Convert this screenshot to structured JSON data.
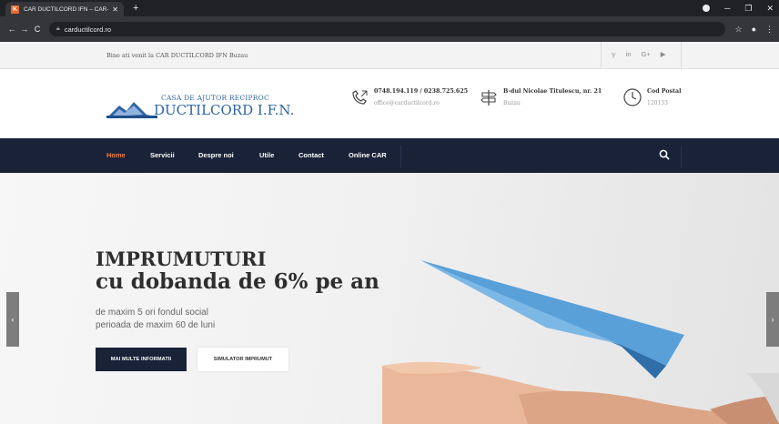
{
  "browser": {
    "tab_title": "CAR DUCTILCORD IFN – CAR-ul ...",
    "tab_favicon": "K",
    "new_tab": "+",
    "url": "carductilcord.ro",
    "icons": [
      "back-icon",
      "forward-icon",
      "reload-icon",
      "lock-icon",
      "star-icon",
      "profile-icon",
      "menu-icon"
    ]
  },
  "topbar": {
    "welcome": "Bine ati venit la CAR DUCTILCORD IFN Buzau",
    "social": {
      "twitter": "𝕪",
      "linkedin": "in",
      "googleplus": "G+",
      "youtube": "▶"
    }
  },
  "header": {
    "logo_line1": "CASA DE AJUTOR RECIPROC",
    "logo_line2": "DUCTILCORD I.F.N.",
    "phone": {
      "title": "0748.194.119 / 0238.725.625",
      "sub": "office@carductilcord.ro"
    },
    "address": {
      "title": "B-dul Nicolae Titulescu, nr. 21",
      "sub": "Buzau"
    },
    "postal": {
      "title": "Cod Postal",
      "sub": "120133"
    }
  },
  "nav": {
    "items": [
      "Home",
      "Servicii",
      "Despre noi",
      "Utile",
      "Contact",
      "Online CAR"
    ],
    "active": "Home"
  },
  "hero": {
    "title_line1": "IMPRUMUTURI",
    "title_line2": "cu dobanda de 6% pe an",
    "sub_line1": "de maxim 5 ori fondul social",
    "sub_line2": "perioada de maxim 60 de luni",
    "btn_primary": "MAI MULTE INFORMATII",
    "btn_secondary": "SIMULATOR IMPRUMUT",
    "arrow_left": "‹",
    "arrow_right": "›"
  },
  "colors": {
    "navy": "#1a2238",
    "accent_orange": "#f57c3f",
    "logo_blue": "#2f64a3"
  }
}
